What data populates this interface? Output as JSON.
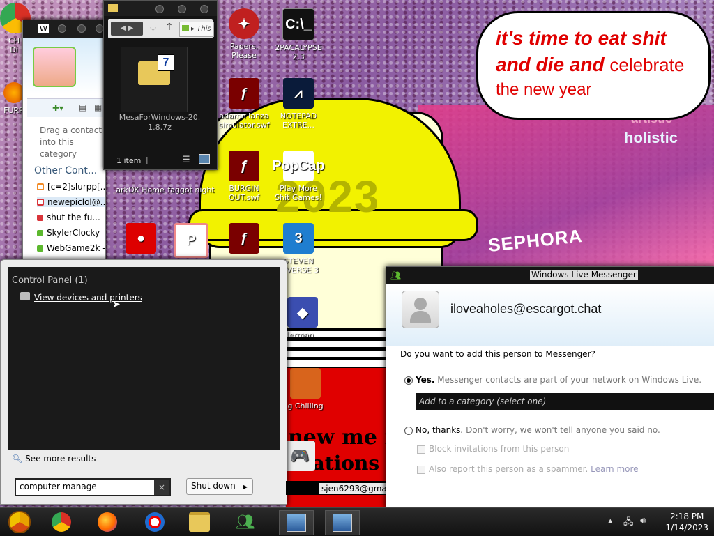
{
  "speech_bubble": {
    "line1": "it's time to eat shit",
    "line2a": "and die and",
    "line2b": "celebrate",
    "line3": "the new year"
  },
  "drawing": {
    "year": "2023",
    "caption": "new me n",
    "caption2": "mations re",
    "sign1": "SEPHORA",
    "sign2": "holistic",
    "sign3": "artistic"
  },
  "desktop_icons": [
    {
      "label": "CH\nDi",
      "icon": "chrome-icon"
    },
    {
      "label": "FURR",
      "icon": "firefox-icon"
    },
    {
      "label": "Papers,\nPlease",
      "icon": "papers-please-icon"
    },
    {
      "label": "2PACALYPSE\n2.3",
      "icon": "cmd-icon"
    },
    {
      "label": "adamn lanza\nsimulator.swf",
      "icon": "flash-icon"
    },
    {
      "label": "NOTEPAD\nEXTRE...",
      "icon": "notepad-icon"
    },
    {
      "label": "arkOK Home",
      "icon": "app-icon"
    },
    {
      "label": "faggot night",
      "icon": "app-icon"
    },
    {
      "label": "BURGIN\nOUT.swf",
      "icon": "flash-icon"
    },
    {
      "label": "Play More\nShit Games!",
      "icon": "popcap-icon"
    },
    {
      "label": "STEVEN\nNIVERSE 3",
      "icon": "game3-icon"
    },
    {
      "label": "derman...",
      "icon": "star-icon"
    },
    {
      "label": "g Chilling",
      "icon": "app-icon"
    }
  ],
  "explorer": {
    "breadcrumb": "This",
    "file_name": "MesaForWindows-20.1.8.7z",
    "status": "1 item"
  },
  "wlm_contacts": {
    "title": "W",
    "hint": "Drag a contact into this category",
    "category": "Other Cont...",
    "contacts": [
      {
        "name": "[c=2]slurpp[...",
        "status_color": "#f28c28"
      },
      {
        "name": "newepiclol@...",
        "status_color": "#d9343a"
      },
      {
        "name": "shut the fu...",
        "status_color": "#d9343a"
      },
      {
        "name": "SkylerClocky -",
        "status_color": "#5cb82e"
      },
      {
        "name": "WebGame2k -",
        "status_color": "#5cb82e"
      }
    ]
  },
  "start_search": {
    "section_header": "Control Panel (1)",
    "result_label": "View devices and printers",
    "see_more": "See more results",
    "query": "computer manage",
    "clear_label": "×",
    "shutdown_label": "Shut down",
    "shutdown_arrow": "▸"
  },
  "messenger_dialog": {
    "title": "Windows Live Messenger",
    "address": "iloveaholes@escargot.chat",
    "question": "Do you want to add this person to Messenger?",
    "yes_bold": "Yes.",
    "yes_desc": "Messenger contacts are part of your network on Windows Live.",
    "category_placeholder": "Add to a category (select one)",
    "no_bold": "No, thanks.",
    "no_desc": "Don't worry, we won't tell anyone you said no.",
    "block_label": "Block invitations from this person",
    "report_label": "Also report this person as a spammer.",
    "learn_more": "Learn more"
  },
  "email_tag": "sjen6293@gmai",
  "taskbar": {
    "time": "2:18 PM",
    "date": "1/14/2023",
    "items": [
      "chrome-canary",
      "chrome",
      "firefox",
      "opera",
      "explorer",
      "messenger",
      "install1",
      "install2"
    ]
  },
  "colors": {
    "accent_red": "#e00000",
    "hat_yellow": "#f2f200",
    "taskbar": "#1a1a1a"
  }
}
